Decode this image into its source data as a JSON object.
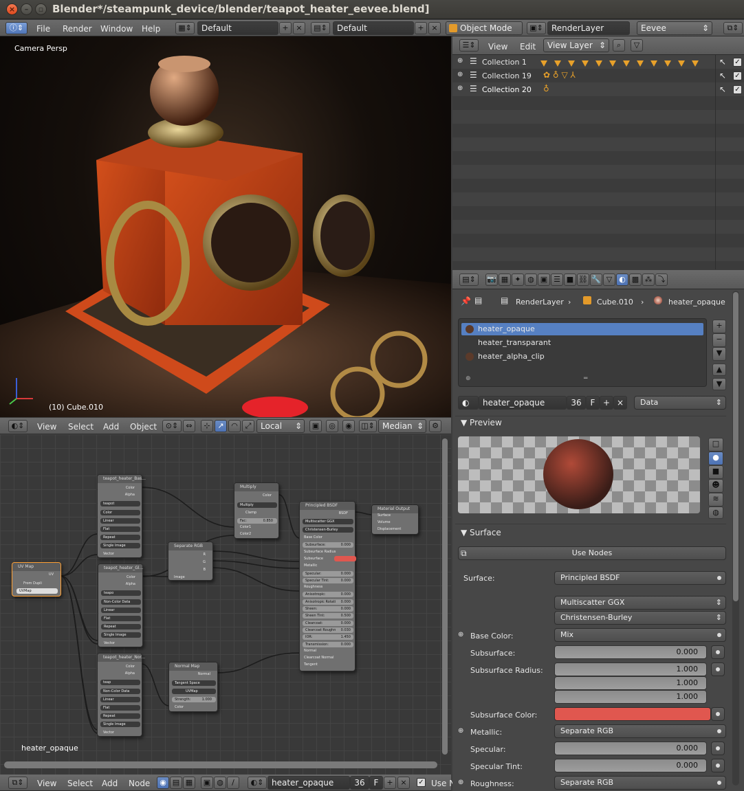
{
  "window": {
    "title": "Blender*/steampunk_device/blender/teapot_heater_eevee.blend]"
  },
  "topbar": {
    "menus": [
      "File",
      "Render",
      "Window",
      "Help"
    ],
    "layout1": "Default",
    "layout2": "Default",
    "mode": "Object Mode",
    "render_layer": "RenderLayer",
    "engine": "Eevee"
  },
  "viewport": {
    "label": "Camera Persp",
    "object_label": "(10) Cube.010",
    "header_menus": [
      "View",
      "Select",
      "Add",
      "Object"
    ],
    "orientation": "Local",
    "pivot": "Median"
  },
  "outliner": {
    "menus": [
      "View",
      "Edit"
    ],
    "display_mode": "View Layer",
    "collections": [
      {
        "name": "Collection 1"
      },
      {
        "name": "Collection 19"
      },
      {
        "name": "Collection 20"
      }
    ]
  },
  "properties": {
    "breadcrumb": [
      "RenderLayer",
      "Cube.010",
      "heater_opaque"
    ],
    "materials": [
      "heater_opaque",
      "heater_transparant",
      "heater_alpha_clip"
    ],
    "material_name": "heater_opaque",
    "users": "36",
    "fake": "F",
    "link": "Data",
    "preview_title": "Preview",
    "surface_title": "Surface",
    "use_nodes": "Use Nodes",
    "surface_label": "Surface:",
    "surface_value": "Principled BSDF",
    "distribution": "Multiscatter GGX",
    "sss_method": "Christensen-Burley",
    "fields": {
      "base_color_label": "Base Color:",
      "base_color_value": "Mix",
      "subsurface_label": "Subsurface:",
      "subsurface_value": "0.000",
      "subsurface_radius_label": "Subsurface Radius:",
      "radius": [
        "1.000",
        "1.000",
        "1.000"
      ],
      "subsurface_color_label": "Subsurface Color:",
      "subsurface_color": "#e0574f",
      "metallic_label": "Metallic:",
      "metallic_value": "Separate RGB",
      "specular_label": "Specular:",
      "specular_value": "0.000",
      "specular_tint_label": "Specular Tint:",
      "specular_tint_value": "0.000",
      "roughness_label": "Roughness:",
      "roughness_value": "Separate RGB"
    }
  },
  "node_editor": {
    "material_label": "heater_opaque",
    "header_menus": [
      "View",
      "Select",
      "Add",
      "Node"
    ],
    "material_name": "heater_opaque",
    "users": "36",
    "fake": "F",
    "use_nodes_label": "Use N",
    "nodes": {
      "uvmap": {
        "title": "UV Map",
        "out": "UV",
        "from_dupli": "From Dupli",
        "map": "UVMap"
      },
      "tex1": {
        "title": "teapot_heater_Bas...",
        "color": "Color",
        "alpha": "Alpha",
        "img": "teapot",
        "colorspace": "Color",
        "interp": "Linear",
        "proj": "Flat",
        "ext": "Repeat",
        "src": "Single Image",
        "vector": "Vector"
      },
      "tex2": {
        "title": "teapot_heater_Gl...",
        "color": "Color",
        "alpha": "Alpha",
        "img": "teapo",
        "colorspace": "Non-Color Data",
        "interp": "Linear",
        "proj": "Flat",
        "ext": "Repeat",
        "src": "Single Image",
        "vector": "Vector"
      },
      "tex3": {
        "title": "teapot_heater_Nor...",
        "color": "Color",
        "alpha": "Alpha",
        "img": "teap",
        "colorspace": "Non-Color Data",
        "interp": "Linear",
        "proj": "Flat",
        "ext": "Repeat",
        "src": "Single Image",
        "vector": "Vector"
      },
      "seprgb": {
        "title": "Separate RGB",
        "r": "R",
        "g": "G",
        "b": "B",
        "image": "Image"
      },
      "mix": {
        "title": "Multiply",
        "color": "Color",
        "blend": "Multiply",
        "clamp": "Clamp",
        "fac": "Fac:",
        "fac_val": "0.850",
        "c1": "Color1",
        "c2": "Color2"
      },
      "normalmap": {
        "title": "Normal Map",
        "normal": "Normal",
        "space": "Tangent Space",
        "map": "UVMap",
        "strength": "Strength:",
        "strength_val": "1.000",
        "color": "Color"
      },
      "bsdf": {
        "title": "Principled BSDF",
        "out": "BSDF",
        "dist": "Multiscatter GGX",
        "sss": "Christensen-Burley",
        "rows": [
          [
            "Base Color",
            ""
          ],
          [
            "Subsurface:",
            "0.000"
          ],
          [
            "Subsurface Radius",
            ""
          ],
          [
            "Subsurface",
            ""
          ],
          [
            "Metallic",
            ""
          ],
          [
            "Specular:",
            "0.000"
          ],
          [
            "Specular Tint:",
            "0.000"
          ],
          [
            "Roughness",
            ""
          ],
          [
            "Anisotropic:",
            "0.000"
          ],
          [
            "Anisotropic Rotati",
            "0.000"
          ],
          [
            "Sheen:",
            "0.000"
          ],
          [
            "Sheen Tint:",
            "0.500"
          ],
          [
            "Clearcoat:",
            "0.000"
          ],
          [
            "Clearcoat Roughn",
            "0.030"
          ],
          [
            "IOR:",
            "1.450"
          ],
          [
            "Transmission:",
            "0.000"
          ],
          [
            "Normal",
            ""
          ],
          [
            "Clearcoat Normal",
            ""
          ],
          [
            "Tangent",
            ""
          ]
        ]
      },
      "output": {
        "title": "Material Output",
        "surface": "Surface",
        "volume": "Volume",
        "disp": "Displacement"
      }
    }
  }
}
